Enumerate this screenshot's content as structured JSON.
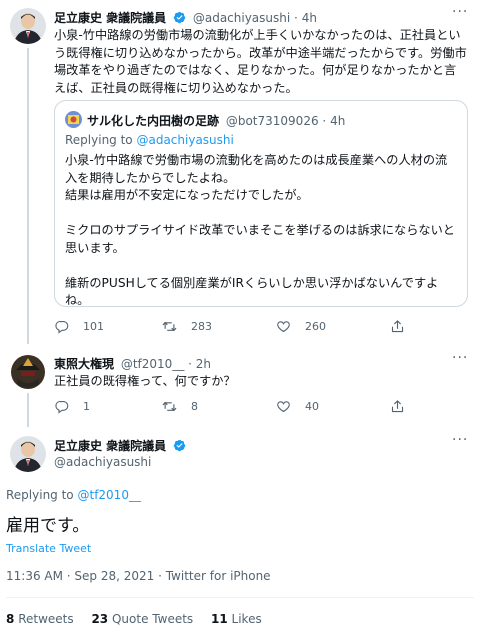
{
  "tweet1": {
    "author_name": "足立康史 衆議院議員",
    "handle": "@adachiyasushi",
    "time": "4h",
    "text": "小泉-竹中路線の労働市場の流動化が上手くいかなかったのは、正社員という既得権に切り込めなかったから。改革が中途半端だったからです。労働市場改革をやり過ぎたのではなく、足りなかった。何が足りなかったかと言えば、正社員の既得権に切り込めなかった。",
    "quote": {
      "author_name": "サル化した内田樹の足跡",
      "handle": "@bot73109026",
      "time": "4h",
      "replying_prefix": "Replying to",
      "replying_to": "@adachiyasushi",
      "text": "小泉-竹中路線で労働市場の流動化を高めたのは成長産業への人材の流入を期待したからでしたよね。\n結果は雇用が不安定になっただけでしたが。\n\nミクロのサプライサイド改革でいまそこを挙げるのは訴求にならないと思います。\n\n維新のPUSHしてる個別産業がIRくらいしか思い浮かばないんですよね。"
    },
    "actions": {
      "replies": "101",
      "retweets": "283",
      "likes": "260"
    }
  },
  "tweet2": {
    "author_name": "東照大権現",
    "handle": "@tf2010__",
    "time": "2h",
    "text": "正社員の既得権って、何ですか？",
    "actions": {
      "replies": "1",
      "retweets": "8",
      "likes": "40"
    }
  },
  "main_tweet": {
    "author_name": "足立康史 衆議院議員",
    "handle": "@adachiyasushi",
    "replying_prefix": "Replying to",
    "replying_to": "@tf2010__",
    "text": "雇用です。",
    "translate": "Translate Tweet",
    "timestamp": "11:36 AM · Sep 28, 2021 · Twitter for iPhone",
    "stats": {
      "retweets_count": "8",
      "retweets_label": "Retweets",
      "quotes_count": "23",
      "quotes_label": "Quote Tweets",
      "likes_count": "11",
      "likes_label": "Likes"
    }
  },
  "colors": {
    "accent": "#1d9bf0",
    "muted": "#536471",
    "border": "#cfd9de",
    "text": "#0f1419"
  },
  "icons": [
    "more-icon",
    "verified-icon",
    "reply-icon",
    "retweet-icon",
    "like-icon",
    "share-icon"
  ]
}
